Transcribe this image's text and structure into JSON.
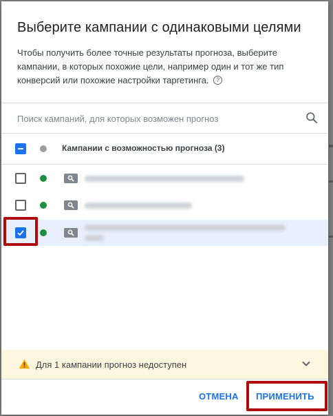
{
  "dialog": {
    "title": "Выберите кампании с одинаковыми целями",
    "description": "Чтобы получить более точные результаты прогноза, выберите кампании, в которых похожие цели, например один и тот же тип конверсий или похожие настройки таргетинга.",
    "help_icon": "?"
  },
  "search": {
    "placeholder": "Поиск кампаний, для которых возможен прогноз",
    "icon": "search-icon"
  },
  "campaigns": {
    "header_label": "Кампании с возможностью прогноза (3)",
    "header_checkbox_state": "indeterminate",
    "items": [
      {
        "checked": false,
        "status": "active",
        "type_icon": "search-campaign-icon"
      },
      {
        "checked": false,
        "status": "active",
        "type_icon": "search-campaign-icon"
      },
      {
        "checked": true,
        "status": "active",
        "type_icon": "search-campaign-icon"
      }
    ]
  },
  "warning": {
    "text": "Для 1 кампании прогноз недоступен",
    "icon": "warning-icon"
  },
  "actions": {
    "cancel_label": "ОТМЕНА",
    "apply_label": "ПРИМЕНИТЬ"
  },
  "colors": {
    "accent": "#1a73e8",
    "status_active": "#1e8e3e",
    "status_inactive": "#9aa0a6",
    "warning_bg": "#fef7e0",
    "warning_icon": "#f9ab00",
    "annotation": "#b00b0b"
  }
}
